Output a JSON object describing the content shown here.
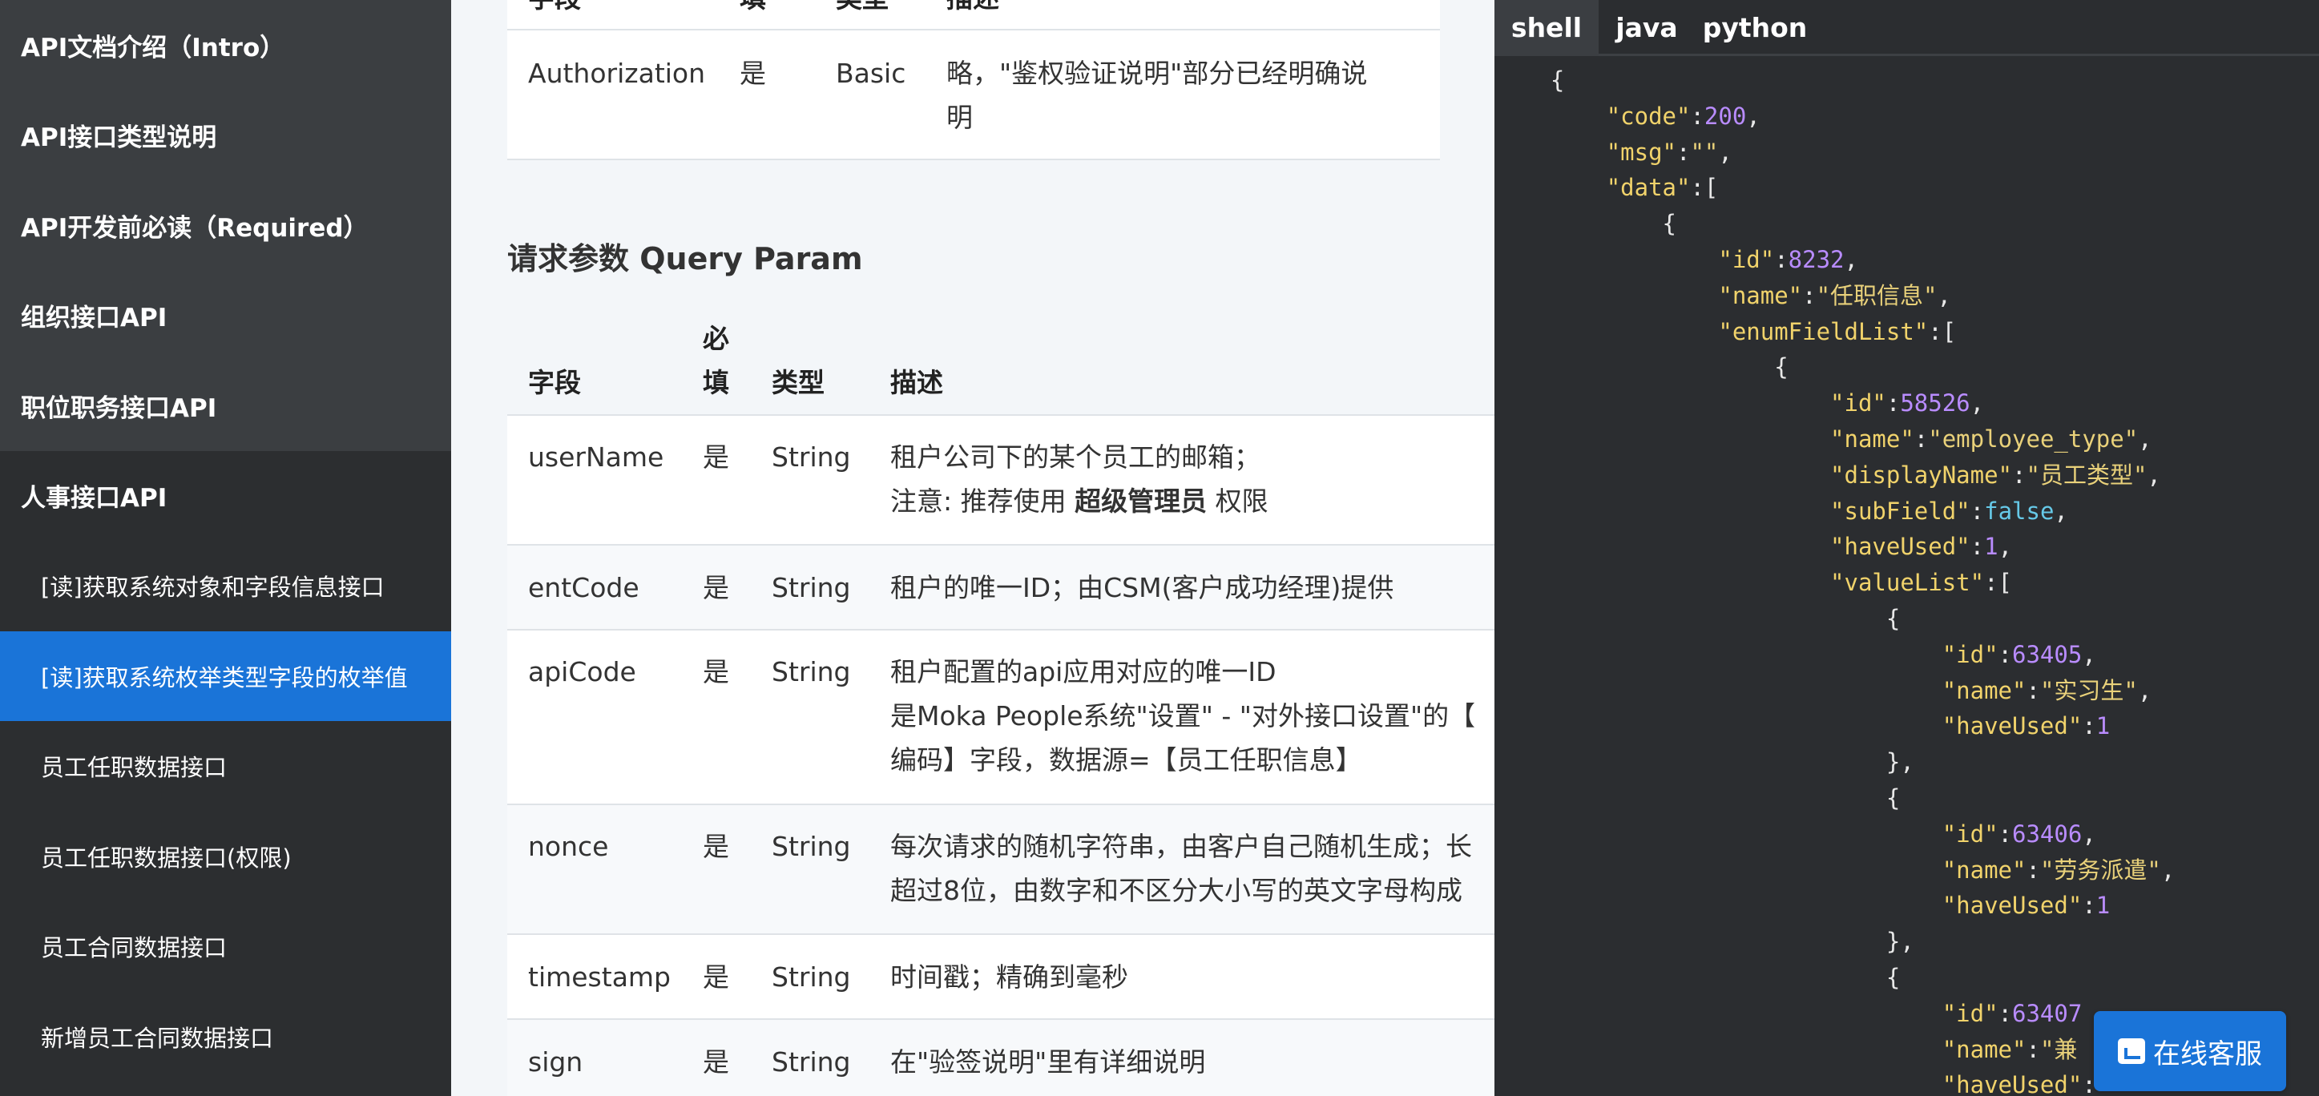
{
  "sidebar": {
    "items": [
      {
        "label": "API文档介绍（Intro）"
      },
      {
        "label": "API接口类型说明"
      },
      {
        "label": "API开发前必读（Required）"
      },
      {
        "label": "组织接口API"
      },
      {
        "label": "职位职务接口API"
      },
      {
        "label": "人事接口API"
      }
    ],
    "sub_items": [
      {
        "label": "[读]获取系统对象和字段信息接口",
        "active": false
      },
      {
        "label": "[读]获取系统枚举类型字段的枚举值",
        "active": true
      },
      {
        "label": "员工任职数据接口",
        "active": false
      },
      {
        "label": "员工任职数据接口(权限)",
        "active": false
      },
      {
        "label": "员工合同数据接口",
        "active": false
      },
      {
        "label": "新增员工合同数据接口",
        "active": false
      }
    ],
    "active_color": "#1a74d8"
  },
  "header_table": {
    "columns": [
      "字段",
      "填",
      "类型",
      "描述"
    ],
    "rows": [
      {
        "field": "Authorization",
        "required": "是",
        "type": "Basic",
        "desc": [
          "略，\"鉴权验证说明\"部分已经明确说",
          "明"
        ]
      }
    ]
  },
  "query_section": {
    "title": "请求参数 Query Param",
    "columns": {
      "field": "字段",
      "required_1": "必",
      "required_2": "填",
      "type": "类型",
      "desc": "描述"
    },
    "rows": [
      {
        "field": "userName",
        "required": "是",
        "type": "String",
        "desc_1": "租户公司下的某个员工的邮箱；",
        "desc_2_prefix": "注意: 推荐使用 ",
        "desc_2_bold": "超级管理员",
        "desc_2_suffix": " 权限"
      },
      {
        "field": "entCode",
        "required": "是",
        "type": "String",
        "desc_1": "租户的唯一ID；由CSM(客户成功经理)提供"
      },
      {
        "field": "apiCode",
        "required": "是",
        "type": "String",
        "desc_1": "租户配置的api应用对应的唯一ID",
        "desc_2": "是Moka People系统\"设置\" - \"对外接口设置\"的【",
        "desc_3": "编码】字段，数据源=【员工任职信息】"
      },
      {
        "field": "nonce",
        "required": "是",
        "type": "String",
        "desc_1": "每次请求的随机字符串，由客户自己随机生成；长",
        "desc_2": "超过8位，由数字和不区分大小写的英文字母构成"
      },
      {
        "field": "timestamp",
        "required": "是",
        "type": "String",
        "desc_1": "时间戳；精确到毫秒"
      },
      {
        "field": "sign",
        "required": "是",
        "type": "String",
        "desc_1": "在\"验签说明\"里有详细说明"
      }
    ]
  },
  "code_panel": {
    "tabs": [
      {
        "label": "shell",
        "active": true
      },
      {
        "label": "java",
        "active": false
      },
      {
        "label": "python",
        "active": false
      }
    ],
    "lines": [
      [
        {
          "t": "    {",
          "c": "p"
        }
      ],
      [
        {
          "t": "        ",
          "c": "p"
        },
        {
          "t": "\"code\"",
          "c": "k"
        },
        {
          "t": ":",
          "c": "p"
        },
        {
          "t": "200",
          "c": "n"
        },
        {
          "t": ",",
          "c": "p"
        }
      ],
      [
        {
          "t": "        ",
          "c": "p"
        },
        {
          "t": "\"msg\"",
          "c": "k"
        },
        {
          "t": ":",
          "c": "p"
        },
        {
          "t": "\"\"",
          "c": "s"
        },
        {
          "t": ",",
          "c": "p"
        }
      ],
      [
        {
          "t": "        ",
          "c": "p"
        },
        {
          "t": "\"data\"",
          "c": "k"
        },
        {
          "t": ":[",
          "c": "p"
        }
      ],
      [
        {
          "t": "            {",
          "c": "p"
        }
      ],
      [
        {
          "t": "                ",
          "c": "p"
        },
        {
          "t": "\"id\"",
          "c": "k"
        },
        {
          "t": ":",
          "c": "p"
        },
        {
          "t": "8232",
          "c": "n"
        },
        {
          "t": ",",
          "c": "p"
        }
      ],
      [
        {
          "t": "                ",
          "c": "p"
        },
        {
          "t": "\"name\"",
          "c": "k"
        },
        {
          "t": ":",
          "c": "p"
        },
        {
          "t": "\"任职信息\"",
          "c": "s"
        },
        {
          "t": ",",
          "c": "p"
        }
      ],
      [
        {
          "t": "                ",
          "c": "p"
        },
        {
          "t": "\"enumFieldList\"",
          "c": "k"
        },
        {
          "t": ":[",
          "c": "p"
        }
      ],
      [
        {
          "t": "                    {",
          "c": "p"
        }
      ],
      [
        {
          "t": "                        ",
          "c": "p"
        },
        {
          "t": "\"id\"",
          "c": "k"
        },
        {
          "t": ":",
          "c": "p"
        },
        {
          "t": "58526",
          "c": "n"
        },
        {
          "t": ",",
          "c": "p"
        }
      ],
      [
        {
          "t": "                        ",
          "c": "p"
        },
        {
          "t": "\"name\"",
          "c": "k"
        },
        {
          "t": ":",
          "c": "p"
        },
        {
          "t": "\"employee_type\"",
          "c": "s"
        },
        {
          "t": ",",
          "c": "p"
        }
      ],
      [
        {
          "t": "                        ",
          "c": "p"
        },
        {
          "t": "\"displayName\"",
          "c": "k"
        },
        {
          "t": ":",
          "c": "p"
        },
        {
          "t": "\"员工类型\"",
          "c": "s"
        },
        {
          "t": ",",
          "c": "p"
        }
      ],
      [
        {
          "t": "                        ",
          "c": "p"
        },
        {
          "t": "\"subField\"",
          "c": "k"
        },
        {
          "t": ":",
          "c": "p"
        },
        {
          "t": "false",
          "c": "b"
        },
        {
          "t": ",",
          "c": "p"
        }
      ],
      [
        {
          "t": "                        ",
          "c": "p"
        },
        {
          "t": "\"haveUsed\"",
          "c": "k"
        },
        {
          "t": ":",
          "c": "p"
        },
        {
          "t": "1",
          "c": "n"
        },
        {
          "t": ",",
          "c": "p"
        }
      ],
      [
        {
          "t": "                        ",
          "c": "p"
        },
        {
          "t": "\"valueList\"",
          "c": "k"
        },
        {
          "t": ":[",
          "c": "p"
        }
      ],
      [
        {
          "t": "                            {",
          "c": "p"
        }
      ],
      [
        {
          "t": "                                ",
          "c": "p"
        },
        {
          "t": "\"id\"",
          "c": "k"
        },
        {
          "t": ":",
          "c": "p"
        },
        {
          "t": "63405",
          "c": "n"
        },
        {
          "t": ",",
          "c": "p"
        }
      ],
      [
        {
          "t": "                                ",
          "c": "p"
        },
        {
          "t": "\"name\"",
          "c": "k"
        },
        {
          "t": ":",
          "c": "p"
        },
        {
          "t": "\"实习生\"",
          "c": "s"
        },
        {
          "t": ",",
          "c": "p"
        }
      ],
      [
        {
          "t": "                                ",
          "c": "p"
        },
        {
          "t": "\"haveUsed\"",
          "c": "k"
        },
        {
          "t": ":",
          "c": "p"
        },
        {
          "t": "1",
          "c": "n"
        }
      ],
      [
        {
          "t": "                            },",
          "c": "p"
        }
      ],
      [
        {
          "t": "                            {",
          "c": "p"
        }
      ],
      [
        {
          "t": "                                ",
          "c": "p"
        },
        {
          "t": "\"id\"",
          "c": "k"
        },
        {
          "t": ":",
          "c": "p"
        },
        {
          "t": "63406",
          "c": "n"
        },
        {
          "t": ",",
          "c": "p"
        }
      ],
      [
        {
          "t": "                                ",
          "c": "p"
        },
        {
          "t": "\"name\"",
          "c": "k"
        },
        {
          "t": ":",
          "c": "p"
        },
        {
          "t": "\"劳务派遣\"",
          "c": "s"
        },
        {
          "t": ",",
          "c": "p"
        }
      ],
      [
        {
          "t": "                                ",
          "c": "p"
        },
        {
          "t": "\"haveUsed\"",
          "c": "k"
        },
        {
          "t": ":",
          "c": "p"
        },
        {
          "t": "1",
          "c": "n"
        }
      ],
      [
        {
          "t": "                            },",
          "c": "p"
        }
      ],
      [
        {
          "t": "                            {",
          "c": "p"
        }
      ],
      [
        {
          "t": "                                ",
          "c": "p"
        },
        {
          "t": "\"id\"",
          "c": "k"
        },
        {
          "t": ":",
          "c": "p"
        },
        {
          "t": "63407",
          "c": "n"
        }
      ],
      [
        {
          "t": "                                ",
          "c": "p"
        },
        {
          "t": "\"name\"",
          "c": "k"
        },
        {
          "t": ":",
          "c": "p"
        },
        {
          "t": "\"兼",
          "c": "s"
        }
      ],
      [
        {
          "t": "                                ",
          "c": "p"
        },
        {
          "t": "\"haveUsed\"",
          "c": "k"
        },
        {
          "t": ":",
          "c": "p"
        }
      ]
    ]
  },
  "chat_button": {
    "label": "在线客服",
    "icon": "chat-bubble-icon"
  }
}
